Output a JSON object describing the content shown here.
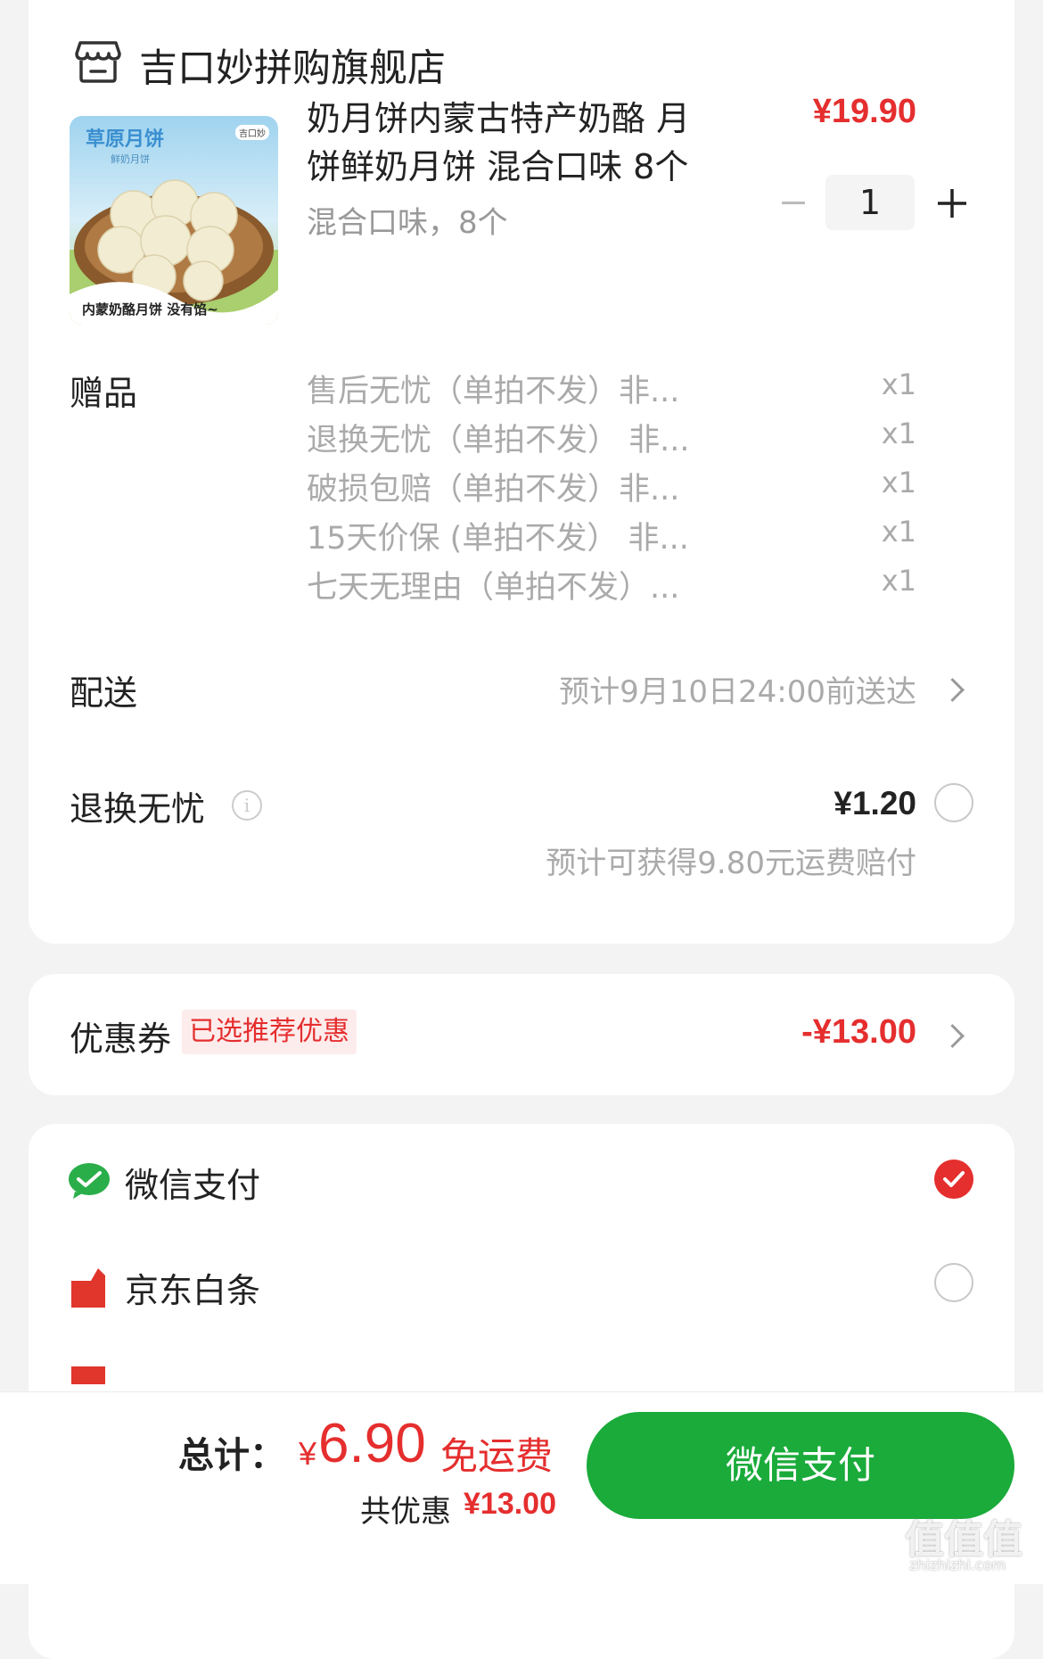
{
  "shop": {
    "name": "吉口妙拼购旗舰店"
  },
  "product": {
    "title_line1": "奶月饼内蒙古特产奶酪 月",
    "title_line2": "饼鲜奶月饼 混合口味 8个",
    "spec": "混合口味，8个",
    "price": "¥19.90",
    "quantity": "1",
    "image_text_title": "草原月饼",
    "image_text_sub": "鲜奶月饼",
    "image_text_bottom": "内蒙奶酪月饼  没有馅~",
    "image_text_brand": "吉口妙"
  },
  "gifts": {
    "label": "赠品",
    "items": [
      {
        "name": "售后无忧（单拍不发）非...",
        "qty": "x1"
      },
      {
        "name": "退换无忧（单拍不发） 非...",
        "qty": "x1"
      },
      {
        "name": "破损包赔（单拍不发）非...",
        "qty": "x1"
      },
      {
        "name": "15天价保 (单拍不发） 非...",
        "qty": "x1"
      },
      {
        "name": "七天无理由（单拍不发）...",
        "qty": "x1"
      }
    ]
  },
  "delivery": {
    "label": "配送",
    "text": "预计9月10日24:00前送达"
  },
  "insurance": {
    "label": "退换无忧",
    "price": "¥1.20",
    "note": "预计可获得9.80元运费赔付"
  },
  "coupon": {
    "label": "优惠券",
    "badge": "已选推荐优惠",
    "amount": "-¥13.00"
  },
  "payment": {
    "methods": [
      {
        "label": "微信支付",
        "selected": true
      },
      {
        "label": "京东白条",
        "selected": false
      }
    ]
  },
  "footer": {
    "total_label": "总计：",
    "currency": "¥",
    "total_amount": "6.90",
    "free_shipping": "免运费",
    "saved_label": "共优惠",
    "saved_amount": "¥13.00",
    "pay_button": "微信支付"
  },
  "watermark": {
    "text": "值值值",
    "sub": "zhizhizhi.com"
  },
  "colors": {
    "accent_red": "#e52e2e",
    "wechat_green": "#1aab3a"
  }
}
